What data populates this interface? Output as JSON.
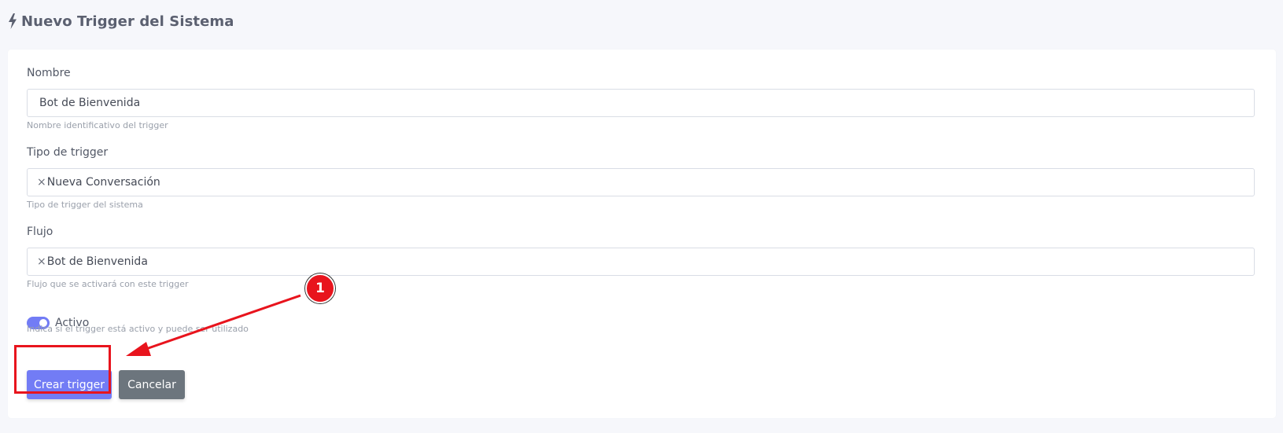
{
  "header": {
    "icon": "bolt-icon",
    "title": "Nuevo Trigger del Sistema"
  },
  "form": {
    "name": {
      "label": "Nombre",
      "value": "Bot de Bienvenida",
      "help": "Nombre identificativo del trigger"
    },
    "trigger_type": {
      "label": "Tipo de trigger",
      "clear_symbol": "×",
      "value": "Nueva Conversación",
      "help": "Tipo de trigger del sistema"
    },
    "flow": {
      "label": "Flujo",
      "clear_symbol": "×",
      "value": "Bot de Bienvenida",
      "help": "Flujo que se activará con este trigger"
    },
    "active": {
      "label": "Activo",
      "checked": true,
      "help": "Indica si el trigger está activo y puede ser utilizado"
    }
  },
  "buttons": {
    "create": "Crear trigger",
    "cancel": "Cancelar"
  },
  "annotation": {
    "step": "1",
    "color": "#e8141d"
  },
  "colors": {
    "primary": "#727cf5",
    "secondary": "#6c757d"
  }
}
